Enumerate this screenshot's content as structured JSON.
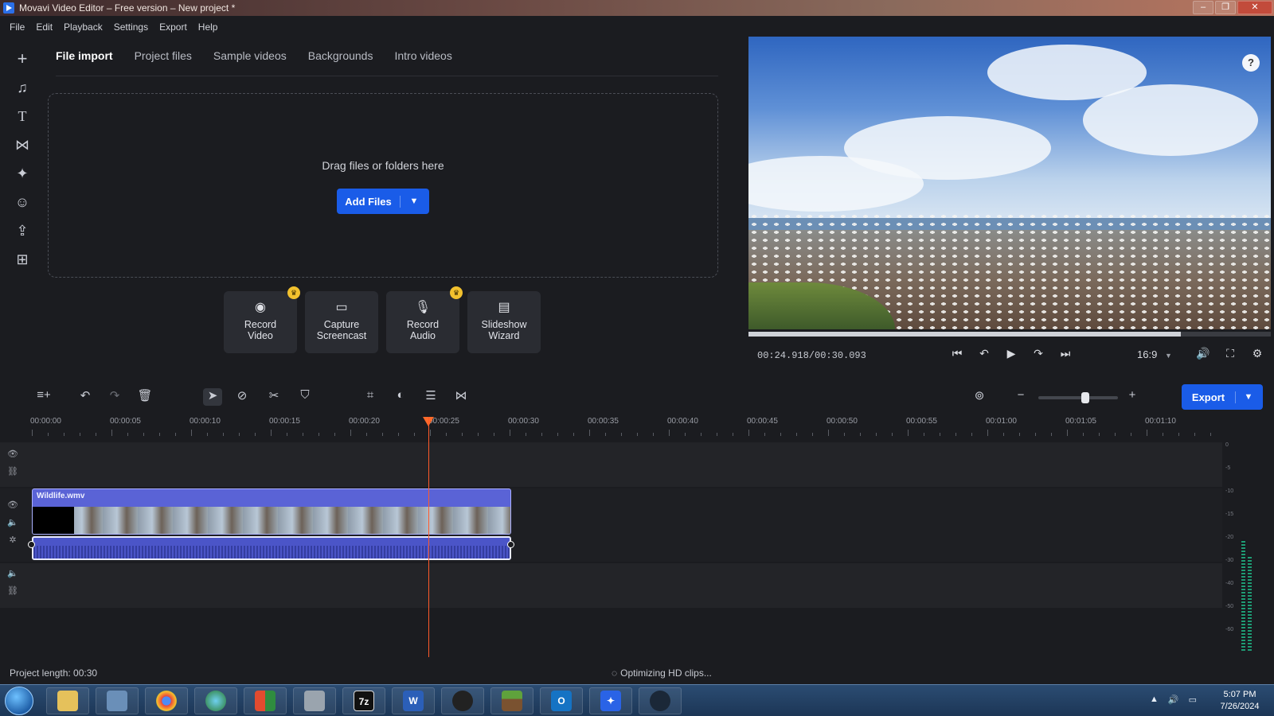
{
  "window": {
    "title": "Movavi Video Editor – Free version – New project *",
    "controls": [
      "minimize-icon",
      "maximize-icon",
      "close-icon"
    ]
  },
  "menu": [
    "File",
    "Edit",
    "Playback",
    "Settings",
    "Export",
    "Help"
  ],
  "rail": [
    "plus-icon",
    "music-note-icon",
    "text-icon",
    "transition-icon",
    "magic-wand-icon",
    "sticker-icon",
    "export-share-icon",
    "more-tools-icon"
  ],
  "import": {
    "tabs": [
      "File import",
      "Project files",
      "Sample videos",
      "Backgrounds",
      "Intro videos"
    ],
    "active_tab": "File import",
    "drop_text": "Drag files or folders here",
    "add_files_label": "Add Files",
    "tools": [
      {
        "label": "Record\nVideo",
        "icon": "webcam-icon",
        "premium": true
      },
      {
        "label": "Capture\nScreencast",
        "icon": "monitor-icon",
        "premium": false
      },
      {
        "label": "Record\nAudio",
        "icon": "microphone-icon",
        "premium": true
      },
      {
        "label": "Slideshow\nWizard",
        "icon": "slideshow-icon",
        "premium": false
      }
    ]
  },
  "player": {
    "time": "00:24.918/00:30.093",
    "progress_fraction": 0.828,
    "aspect": "16:9",
    "help_icon": "question-icon"
  },
  "timeline": {
    "export_label": "Export",
    "ruler": [
      "00:00:00",
      "00:00:05",
      "00:00:10",
      "00:00:15",
      "00:00:20",
      "00:00:25",
      "00:00:30",
      "00:00:35",
      "00:00:40",
      "00:00:45",
      "00:00:50",
      "00:00:55",
      "00:01:00",
      "00:01:05",
      "00:01:10"
    ],
    "playhead_seconds": 24.918,
    "clip_name": "Wildlife.wmv",
    "clip_seconds": 30.093,
    "zoom_fraction": 0.6,
    "meter_labels": [
      "0",
      "-5",
      "-10",
      "-15",
      "-20",
      "-30",
      "-40",
      "-50",
      "-60"
    ]
  },
  "status": {
    "project_length": "Project length: 00:30",
    "optimizing": "Optimizing HD clips..."
  },
  "taskbar": {
    "clock_time": "5:07 PM",
    "clock_date": "7/26/2024"
  },
  "colors": {
    "accent": "#1a5ce8",
    "playhead": "#ff5a2a",
    "clip": "#5a63d6"
  }
}
